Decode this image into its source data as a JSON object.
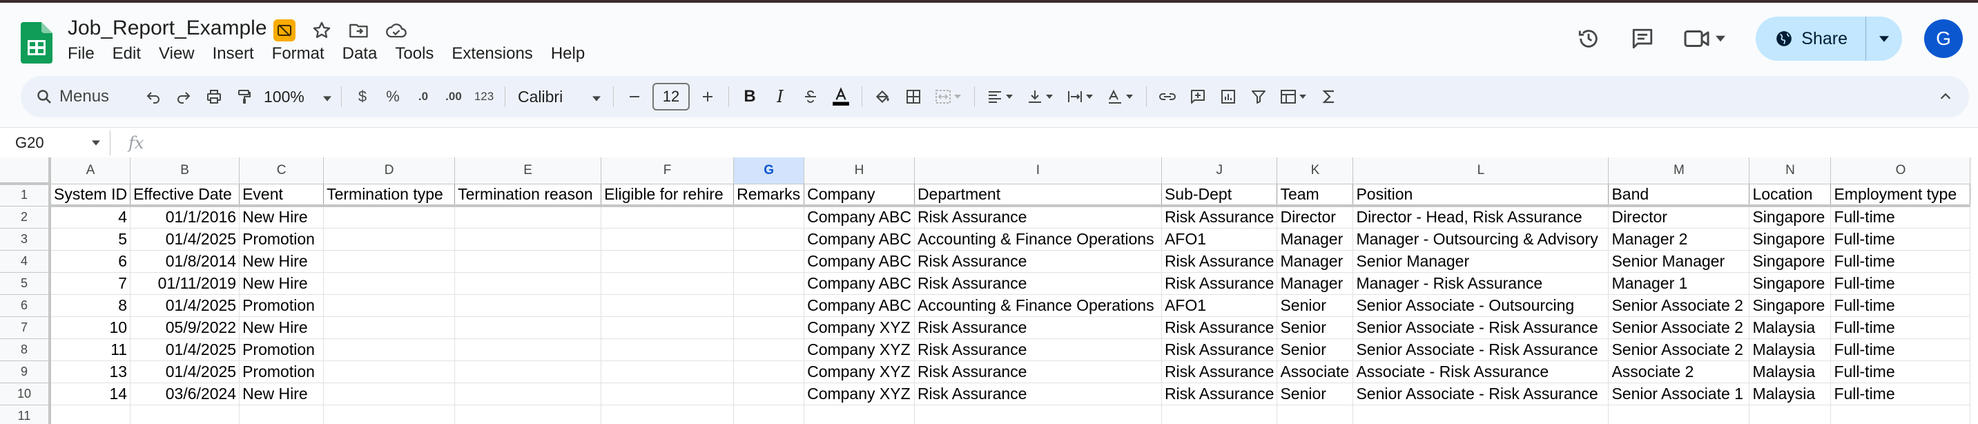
{
  "doc": {
    "title": "Job_Report_Example",
    "menu": [
      "File",
      "Edit",
      "View",
      "Insert",
      "Format",
      "Data",
      "Tools",
      "Extensions",
      "Help"
    ],
    "share_label": "Share",
    "avatar_letter": "G"
  },
  "toolbar": {
    "search_label": "Menus",
    "zoom": "100%",
    "currency": "$",
    "percent": "%",
    "dec_less": ".0",
    "dec_more": ".00",
    "format_123": "123",
    "font_name": "Calibri",
    "font_size": "12",
    "bold": "B",
    "italic": "I"
  },
  "formula_bar": {
    "cell_ref": "G20",
    "fx": "fx",
    "value": ""
  },
  "grid": {
    "selected_column": "G",
    "columns": [
      "A",
      "B",
      "C",
      "D",
      "E",
      "F",
      "G",
      "H",
      "I",
      "J",
      "K",
      "L",
      "M",
      "N",
      "O"
    ],
    "numeric_columns": [
      0,
      1
    ],
    "row_numbers": [
      "1",
      "2",
      "3",
      "4",
      "5",
      "6",
      "7",
      "8",
      "9",
      "10",
      "11"
    ],
    "header": [
      "System ID",
      "Effective Date",
      "Event",
      "Termination type",
      "Termination reason",
      "Eligible for rehire",
      "Remarks",
      "Company",
      "Department",
      "Sub-Dept",
      "Team",
      "Position",
      "Band",
      "Location",
      "Employment type"
    ],
    "rows": [
      [
        "4",
        "01/1/2016",
        "New Hire",
        "",
        "",
        "",
        "",
        "Company ABC",
        "Risk Assurance",
        "Risk Assurance",
        "Director",
        "Director - Head, Risk Assurance",
        "Director",
        "Singapore",
        "Full-time"
      ],
      [
        "5",
        "01/4/2025",
        "Promotion",
        "",
        "",
        "",
        "",
        "Company ABC",
        "Accounting & Finance Operations",
        "AFO1",
        "Manager",
        "Manager - Outsourcing & Advisory",
        "Manager 2",
        "Singapore",
        "Full-time"
      ],
      [
        "6",
        "01/8/2014",
        "New Hire",
        "",
        "",
        "",
        "",
        "Company ABC",
        "Risk Assurance",
        "Risk Assurance",
        "Manager",
        "Senior Manager",
        "Senior Manager",
        "Singapore",
        "Full-time"
      ],
      [
        "7",
        "01/11/2019",
        "New Hire",
        "",
        "",
        "",
        "",
        "Company ABC",
        "Risk Assurance",
        "Risk Assurance",
        "Manager",
        "Manager - Risk Assurance",
        "Manager 1",
        "Singapore",
        "Full-time"
      ],
      [
        "8",
        "01/4/2025",
        "Promotion",
        "",
        "",
        "",
        "",
        "Company ABC",
        "Accounting & Finance Operations",
        "AFO1",
        "Senior",
        "Senior Associate - Outsourcing",
        "Senior Associate 2",
        "Singapore",
        "Full-time"
      ],
      [
        "10",
        "05/9/2022",
        "New Hire",
        "",
        "",
        "",
        "",
        "Company XYZ",
        "Risk Assurance",
        "Risk Assurance",
        "Senior",
        "Senior Associate - Risk Assurance",
        "Senior Associate 2",
        "Malaysia",
        "Full-time"
      ],
      [
        "11",
        "01/4/2025",
        "Promotion",
        "",
        "",
        "",
        "",
        "Company XYZ",
        "Risk Assurance",
        "Risk Assurance",
        "Senior",
        "Senior Associate - Risk Assurance",
        "Senior Associate 2",
        "Malaysia",
        "Full-time"
      ],
      [
        "13",
        "01/4/2025",
        "Promotion",
        "",
        "",
        "",
        "",
        "Company XYZ",
        "Risk Assurance",
        "Risk Assurance",
        "Associate",
        "Associate - Risk Assurance",
        "Associate 2",
        "Malaysia",
        "Full-time"
      ],
      [
        "14",
        "03/6/2024",
        "New Hire",
        "",
        "",
        "",
        "",
        "Company XYZ",
        "Risk Assurance",
        "Risk Assurance",
        "Senior",
        "Senior Associate - Risk Assurance",
        "Senior Associate 1",
        "Malaysia",
        "Full-time"
      ],
      [
        "",
        "",
        "",
        "",
        "",
        "",
        "",
        "",
        "",
        "",
        "",
        "",
        "",
        "",
        ""
      ]
    ]
  },
  "colors": {
    "accent": "#0b57d0",
    "share_bg": "#c2e7ff",
    "sheets_green": "#0f9d58",
    "selected_col_bg": "#d3e3fd"
  }
}
